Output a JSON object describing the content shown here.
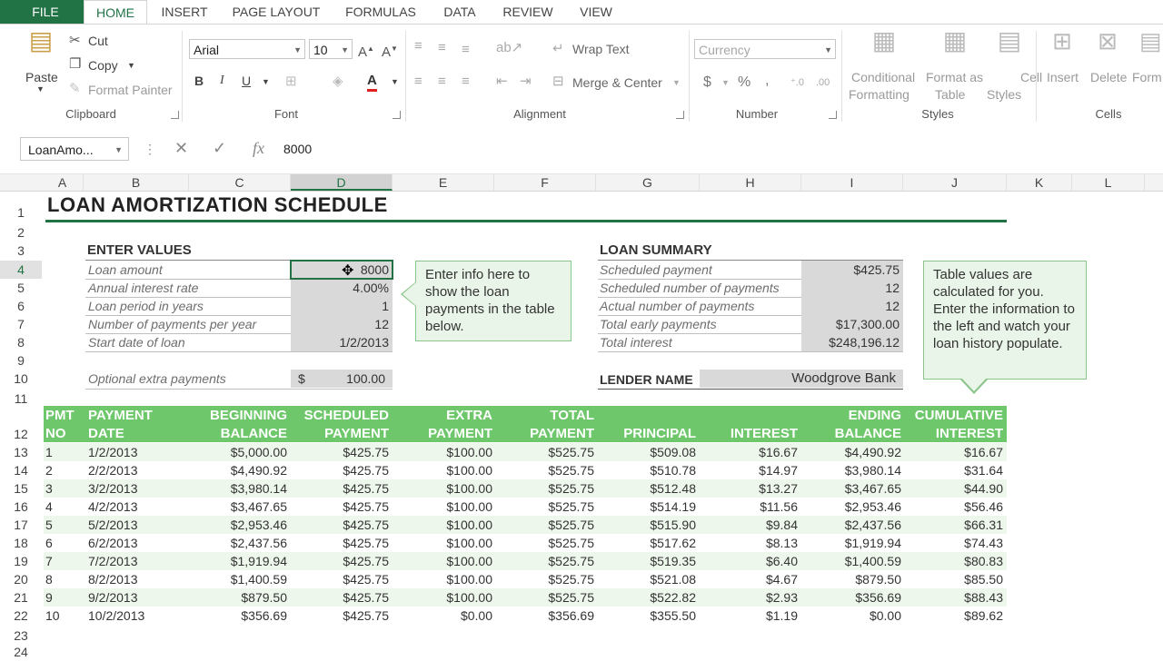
{
  "tabs": [
    "FILE",
    "HOME",
    "INSERT",
    "PAGE LAYOUT",
    "FORMULAS",
    "DATA",
    "REVIEW",
    "VIEW"
  ],
  "ribbon": {
    "clipboard": {
      "paste": "Paste",
      "cut": "Cut",
      "copy": "Copy",
      "format_painter": "Format Painter",
      "label": "Clipboard"
    },
    "font": {
      "name": "Arial",
      "size": "10",
      "label": "Font",
      "bold": "B",
      "italic": "I",
      "underline": "U"
    },
    "alignment": {
      "wrap": "Wrap Text",
      "merge": "Merge & Center",
      "label": "Alignment"
    },
    "number": {
      "format": "Currency",
      "label": "Number",
      "dollar": "$",
      "percent": "%",
      "comma": ","
    },
    "styles": {
      "conditional": "Conditional",
      "conditional2": "Formatting",
      "format_as": "Format as",
      "format_as2": "Table",
      "cell": "Cell",
      "cell2": "Styles",
      "label": "Styles"
    },
    "cells": {
      "insert": "Insert",
      "delete": "Delete",
      "format": "Form",
      "label": "Cells"
    }
  },
  "formula_bar": {
    "name_box": "LoanAmo...",
    "fx": "fx",
    "value": "8000"
  },
  "columns": [
    "A",
    "B",
    "C",
    "D",
    "E",
    "F",
    "G",
    "H",
    "I",
    "J",
    "K",
    "L"
  ],
  "rows": [
    "1",
    "2",
    "3",
    "4",
    "5",
    "6",
    "7",
    "8",
    "9",
    "10",
    "11",
    "12",
    "13",
    "14",
    "15",
    "16",
    "17",
    "18",
    "19",
    "20",
    "21",
    "22",
    "23",
    "24"
  ],
  "sheet": {
    "title": "LOAN AMORTIZATION SCHEDULE",
    "enter_values": {
      "heading": "ENTER VALUES",
      "items": [
        {
          "label": "Loan amount",
          "value": "8000"
        },
        {
          "label": "Annual interest rate",
          "value": "4.00%"
        },
        {
          "label": "Loan period in years",
          "value": "1"
        },
        {
          "label": "Number of payments per year",
          "value": "12"
        },
        {
          "label": "Start date of loan",
          "value": "1/2/2013"
        }
      ],
      "extra_label": "Optional extra payments",
      "extra_currency": "$",
      "extra_value": "100.00"
    },
    "note_left": "Enter info here to show the loan payments in the table below.",
    "summary": {
      "heading": "LOAN SUMMARY",
      "items": [
        {
          "label": "Scheduled payment",
          "value": "$425.75"
        },
        {
          "label": "Scheduled number of payments",
          "value": "12"
        },
        {
          "label": "Actual number of payments",
          "value": "12"
        },
        {
          "label": "Total early payments",
          "value": "$17,300.00"
        },
        {
          "label": "Total interest",
          "value": "$248,196.12"
        }
      ],
      "lender_label": "LENDER NAME",
      "lender_value": "Woodgrove Bank"
    },
    "note_right": "Table values are calculated for you. Enter the information to the left and watch your loan history populate.",
    "table": {
      "headers": [
        [
          "PMT",
          "NO"
        ],
        [
          "PAYMENT",
          "DATE"
        ],
        [
          "BEGINNING",
          "BALANCE"
        ],
        [
          "SCHEDULED",
          "PAYMENT"
        ],
        [
          "EXTRA",
          "PAYMENT"
        ],
        [
          "TOTAL",
          "PAYMENT"
        ],
        [
          "",
          "PRINCIPAL"
        ],
        [
          "",
          "INTEREST"
        ],
        [
          "ENDING",
          "BALANCE"
        ],
        [
          "CUMULATIVE",
          "INTEREST"
        ]
      ],
      "rows": [
        [
          "1",
          "1/2/2013",
          "$5,000.00",
          "$425.75",
          "$100.00",
          "$525.75",
          "$509.08",
          "$16.67",
          "$4,490.92",
          "$16.67"
        ],
        [
          "2",
          "2/2/2013",
          "$4,490.92",
          "$425.75",
          "$100.00",
          "$525.75",
          "$510.78",
          "$14.97",
          "$3,980.14",
          "$31.64"
        ],
        [
          "3",
          "3/2/2013",
          "$3,980.14",
          "$425.75",
          "$100.00",
          "$525.75",
          "$512.48",
          "$13.27",
          "$3,467.65",
          "$44.90"
        ],
        [
          "4",
          "4/2/2013",
          "$3,467.65",
          "$425.75",
          "$100.00",
          "$525.75",
          "$514.19",
          "$11.56",
          "$2,953.46",
          "$56.46"
        ],
        [
          "5",
          "5/2/2013",
          "$2,953.46",
          "$425.75",
          "$100.00",
          "$525.75",
          "$515.90",
          "$9.84",
          "$2,437.56",
          "$66.31"
        ],
        [
          "6",
          "6/2/2013",
          "$2,437.56",
          "$425.75",
          "$100.00",
          "$525.75",
          "$517.62",
          "$8.13",
          "$1,919.94",
          "$74.43"
        ],
        [
          "7",
          "7/2/2013",
          "$1,919.94",
          "$425.75",
          "$100.00",
          "$525.75",
          "$519.35",
          "$6.40",
          "$1,400.59",
          "$80.83"
        ],
        [
          "8",
          "8/2/2013",
          "$1,400.59",
          "$425.75",
          "$100.00",
          "$525.75",
          "$521.08",
          "$4.67",
          "$879.50",
          "$85.50"
        ],
        [
          "9",
          "9/2/2013",
          "$879.50",
          "$425.75",
          "$100.00",
          "$525.75",
          "$522.82",
          "$2.93",
          "$356.69",
          "$88.43"
        ],
        [
          "10",
          "10/2/2013",
          "$356.69",
          "$425.75",
          "$0.00",
          "$356.69",
          "$355.50",
          "$1.19",
          "$0.00",
          "$89.62"
        ]
      ]
    }
  }
}
